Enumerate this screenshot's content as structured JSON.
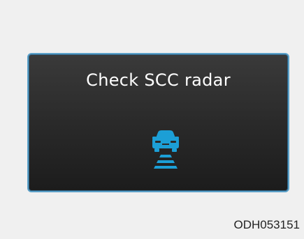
{
  "screen": {
    "message": "Check SCC radar",
    "icon": "scc-radar-car-icon",
    "icon_color": "#1c9fd6",
    "border_color": "#5aa0c8"
  },
  "figure_code": "ODH053151"
}
